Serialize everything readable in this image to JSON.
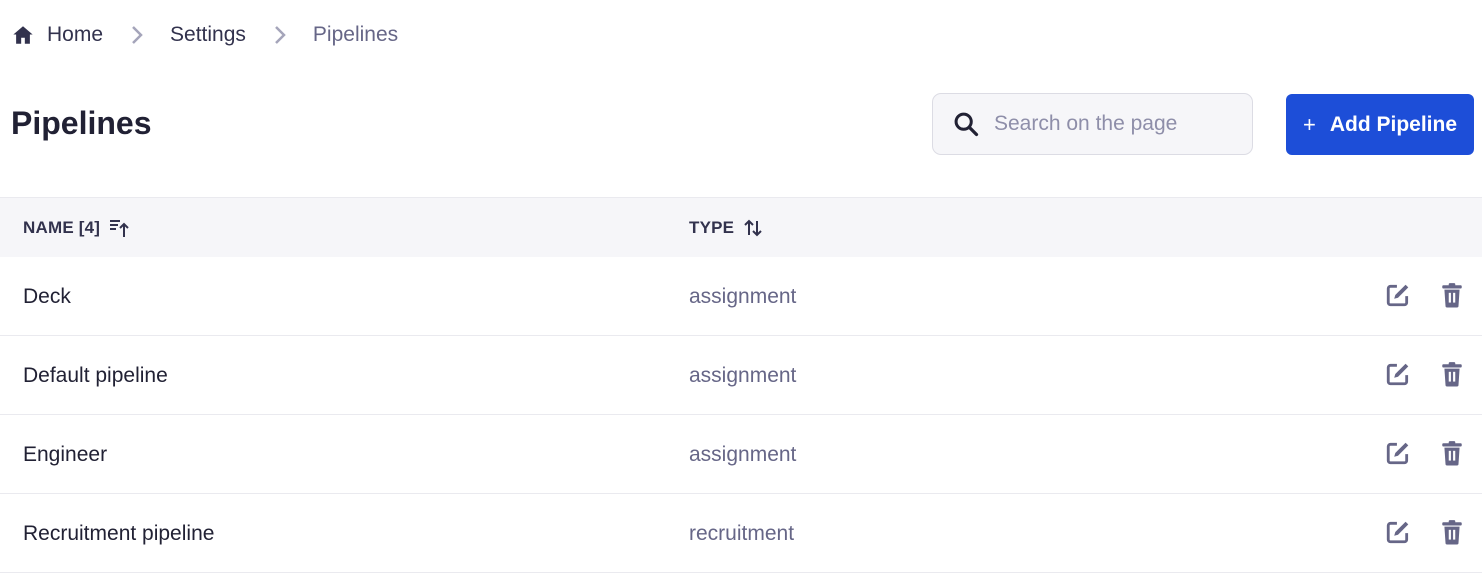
{
  "breadcrumb": {
    "items": [
      {
        "label": "Home",
        "icon": "home-icon"
      },
      {
        "label": "Settings"
      },
      {
        "label": "Pipelines",
        "current": true
      }
    ]
  },
  "header": {
    "title": "Pipelines",
    "search_placeholder": "Search on the page",
    "search_value": "",
    "add_button_label": "Add Pipeline",
    "add_button_icon": "plus-icon"
  },
  "table": {
    "columns": [
      {
        "label": "NAME [4]",
        "sort_icon": "sort-ascending-icon"
      },
      {
        "label": "TYPE",
        "sort_icon": "sort-icon"
      }
    ],
    "rows": [
      {
        "name": "Deck",
        "type": "assignment"
      },
      {
        "name": "Default pipeline",
        "type": "assignment"
      },
      {
        "name": "Engineer",
        "type": "assignment"
      },
      {
        "name": "Recruitment pipeline",
        "type": "recruitment"
      }
    ],
    "row_actions": [
      "edit-icon",
      "delete-icon"
    ]
  },
  "colors": {
    "accent": "#1d4ed8",
    "icon": "#666687",
    "text": "#212134",
    "muted": "#666687",
    "header_bg": "#f6f6f9"
  }
}
